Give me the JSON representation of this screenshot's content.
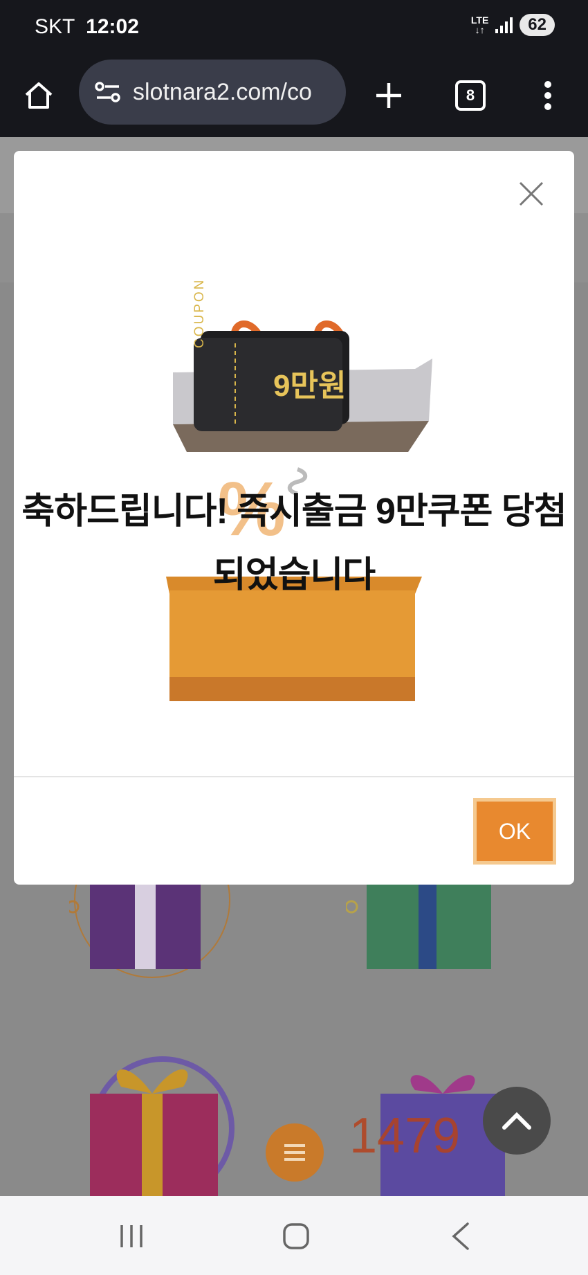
{
  "status_bar": {
    "carrier": "SKT",
    "time": "12:02",
    "network": "LTE",
    "battery": "62"
  },
  "browser": {
    "url": "slotnara2.com/co",
    "tab_count": "8"
  },
  "modal": {
    "coupon_tag": "COUPON",
    "coupon_amount": "9만원",
    "headline": "축하드립니다! 즉시출금 9만쿠폰 당첨 되었습니다",
    "ok_label": "OK"
  },
  "background": {
    "counter": "1479"
  },
  "colors": {
    "accent": "#e8892f",
    "chrome": "#16171c"
  }
}
